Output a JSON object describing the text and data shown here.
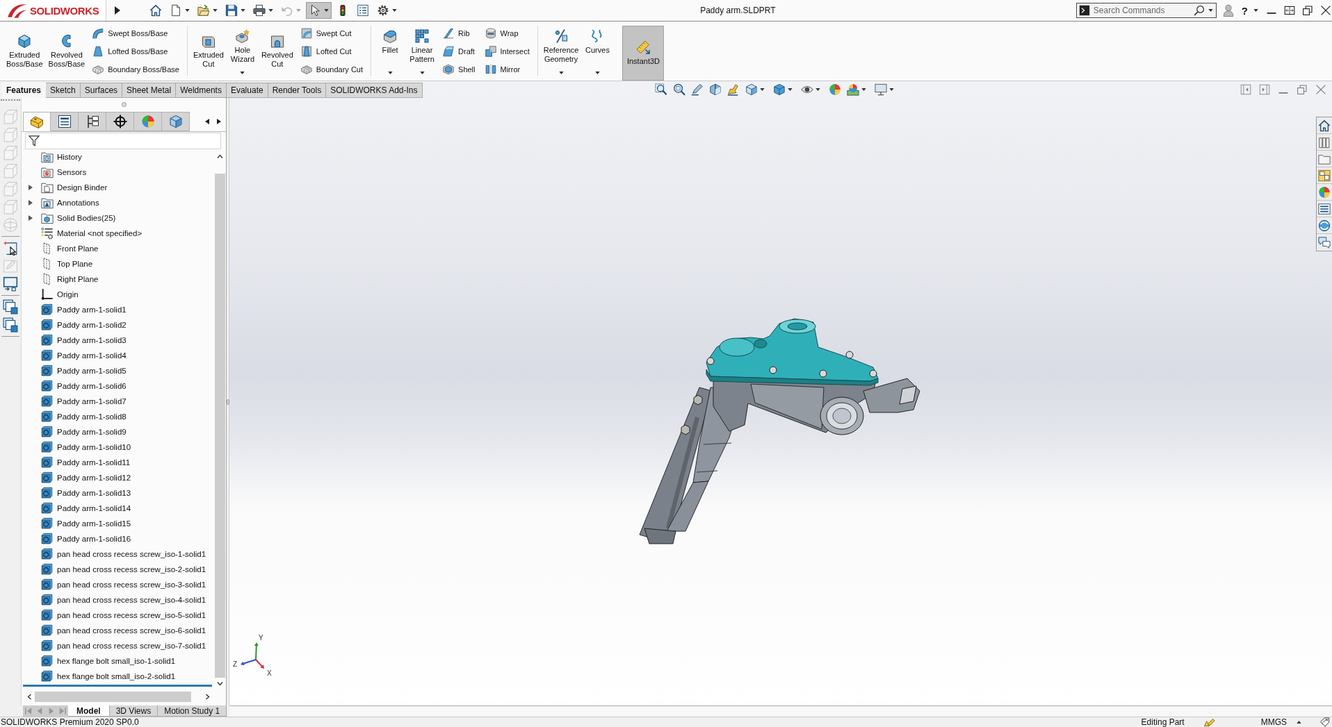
{
  "title_bar": {
    "logo": "SOLIDWORKS",
    "quick_access": [
      {
        "has_menu": false,
        "pressed": false,
        "disabled": false
      },
      {
        "has_menu": true,
        "pressed": false,
        "disabled": false
      },
      {
        "has_menu": true,
        "pressed": false,
        "disabled": false
      },
      {
        "has_menu": true,
        "pressed": false,
        "disabled": false
      },
      {
        "has_menu": true,
        "pressed": false,
        "disabled": false
      },
      {
        "has_menu": true,
        "pressed": false,
        "disabled": true
      },
      {
        "has_menu": true,
        "pressed": true,
        "disabled": false
      },
      {
        "has_menu": false,
        "pressed": false,
        "disabled": false
      },
      {
        "has_menu": false,
        "pressed": false,
        "disabled": false
      },
      {
        "has_menu": true,
        "pressed": false,
        "disabled": false
      }
    ],
    "document_title": "Paddy arm.SLDPRT",
    "search": {
      "placeholder": "Search Commands"
    },
    "help": {
      "label": "?",
      "has_menu": true
    }
  },
  "command_manager": {
    "groups": [
      [
        {
          "kind": "large",
          "label": "Extruded Boss/Base",
          "has_menu": false,
          "pressed": false
        },
        {
          "kind": "large",
          "label": "Revolved Boss/Base",
          "has_menu": false,
          "pressed": false
        },
        {
          "kind": "stack",
          "items": [
            {
              "label": "Swept Boss/Base"
            },
            {
              "label": "Lofted Boss/Base"
            },
            {
              "label": "Boundary Boss/Base"
            }
          ]
        }
      ],
      [
        {
          "kind": "large",
          "label": "Extruded Cut",
          "has_menu": false,
          "pressed": false
        },
        {
          "kind": "large",
          "label": "Hole Wizard",
          "has_menu": true,
          "pressed": false
        },
        {
          "kind": "large",
          "label": "Revolved Cut",
          "has_menu": false,
          "pressed": false
        },
        {
          "kind": "stack",
          "items": [
            {
              "label": "Swept Cut"
            },
            {
              "label": "Lofted Cut"
            },
            {
              "label": "Boundary Cut"
            }
          ]
        }
      ],
      [
        {
          "kind": "large",
          "label": "Fillet",
          "has_menu": true,
          "pressed": false
        },
        {
          "kind": "large",
          "label": "Linear Pattern",
          "has_menu": true,
          "pressed": false
        },
        {
          "kind": "stack",
          "items": [
            {
              "label": "Rib"
            },
            {
              "label": "Draft"
            },
            {
              "label": "Shell"
            }
          ]
        },
        {
          "kind": "stack",
          "items": [
            {
              "label": "Wrap"
            },
            {
              "label": "Intersect"
            },
            {
              "label": "Mirror"
            }
          ]
        }
      ],
      [
        {
          "kind": "large",
          "label": "Reference Geometry",
          "has_menu": true,
          "pressed": false
        },
        {
          "kind": "large",
          "label": "Curves",
          "has_menu": true,
          "pressed": false
        },
        {
          "kind": "large",
          "label": "Instant3D",
          "has_menu": false,
          "pressed": true
        }
      ]
    ],
    "tabs": [
      {
        "label": "Features",
        "selected": true
      },
      {
        "label": "Sketch",
        "selected": false
      },
      {
        "label": "Surfaces",
        "selected": false
      },
      {
        "label": "Sheet Metal",
        "selected": false
      },
      {
        "label": "Weldments",
        "selected": false
      },
      {
        "label": "Evaluate",
        "selected": false
      },
      {
        "label": "Render Tools",
        "selected": false
      },
      {
        "label": "SOLIDWORKS Add-Ins",
        "selected": false
      }
    ]
  },
  "left_toolbar": {
    "groups": [
      [
        {
          "disabled": true
        },
        {
          "disabled": true
        },
        {
          "disabled": true
        },
        {
          "disabled": true
        },
        {
          "disabled": true
        },
        {
          "disabled": true
        },
        {
          "disabled": true
        }
      ],
      [
        {
          "disabled": false
        },
        {
          "disabled": true
        },
        {
          "disabled": false
        }
      ],
      [
        {
          "disabled": false
        },
        {
          "disabled": false
        }
      ]
    ]
  },
  "feature_manager": {
    "tabs": [
      {
        "selected": true
      },
      {
        "selected": false
      },
      {
        "selected": false
      },
      {
        "selected": false
      },
      {
        "selected": false
      },
      {
        "selected": false
      }
    ],
    "tree": [
      {
        "label": "History",
        "kind": "history",
        "expandable": false
      },
      {
        "label": "Sensors",
        "kind": "sensors",
        "expandable": false
      },
      {
        "label": "Design Binder",
        "kind": "binder",
        "expandable": true
      },
      {
        "label": "Annotations",
        "kind": "annotations",
        "expandable": true
      },
      {
        "label": "Solid Bodies(25)",
        "kind": "bodies",
        "expandable": true
      },
      {
        "label": "Material <not specified>",
        "kind": "material",
        "expandable": false
      },
      {
        "label": "Front Plane",
        "kind": "plane",
        "expandable": false
      },
      {
        "label": "Top Plane",
        "kind": "plane",
        "expandable": false
      },
      {
        "label": "Right Plane",
        "kind": "plane",
        "expandable": false
      },
      {
        "label": "Origin",
        "kind": "origin",
        "expandable": false
      },
      {
        "label": "Paddy arm-1-solid1",
        "kind": "body",
        "expandable": false
      },
      {
        "label": "Paddy arm-1-solid2",
        "kind": "body",
        "expandable": false
      },
      {
        "label": "Paddy arm-1-solid3",
        "kind": "body",
        "expandable": false
      },
      {
        "label": "Paddy arm-1-solid4",
        "kind": "body",
        "expandable": false
      },
      {
        "label": "Paddy arm-1-solid5",
        "kind": "body",
        "expandable": false
      },
      {
        "label": "Paddy arm-1-solid6",
        "kind": "body",
        "expandable": false
      },
      {
        "label": "Paddy arm-1-solid7",
        "kind": "body",
        "expandable": false
      },
      {
        "label": "Paddy arm-1-solid8",
        "kind": "body",
        "expandable": false
      },
      {
        "label": "Paddy arm-1-solid9",
        "kind": "body",
        "expandable": false
      },
      {
        "label": "Paddy arm-1-solid10",
        "kind": "body",
        "expandable": false
      },
      {
        "label": "Paddy arm-1-solid11",
        "kind": "body",
        "expandable": false
      },
      {
        "label": "Paddy arm-1-solid12",
        "kind": "body",
        "expandable": false
      },
      {
        "label": "Paddy arm-1-solid13",
        "kind": "body",
        "expandable": false
      },
      {
        "label": "Paddy arm-1-solid14",
        "kind": "body",
        "expandable": false
      },
      {
        "label": "Paddy arm-1-solid15",
        "kind": "body",
        "expandable": false
      },
      {
        "label": "Paddy arm-1-solid16",
        "kind": "body",
        "expandable": false
      },
      {
        "label": "pan head cross recess screw_iso-1-solid1",
        "kind": "body",
        "expandable": false
      },
      {
        "label": "pan head cross recess screw_iso-2-solid1",
        "kind": "body",
        "expandable": false
      },
      {
        "label": "pan head cross recess screw_iso-3-solid1",
        "kind": "body",
        "expandable": false
      },
      {
        "label": "pan head cross recess screw_iso-4-solid1",
        "kind": "body",
        "expandable": false
      },
      {
        "label": "pan head cross recess screw_iso-5-solid1",
        "kind": "body",
        "expandable": false
      },
      {
        "label": "pan head cross recess screw_iso-6-solid1",
        "kind": "body",
        "expandable": false
      },
      {
        "label": "pan head cross recess screw_iso-7-solid1",
        "kind": "body",
        "expandable": false
      },
      {
        "label": "hex flange bolt small_iso-1-solid1",
        "kind": "body",
        "expandable": false
      },
      {
        "label": "hex flange bolt small_iso-2-solid1",
        "kind": "body",
        "expandable": false
      }
    ],
    "tab_nav": [
      {
        "disabled": true
      },
      {
        "disabled": true
      },
      {
        "disabled": true
      },
      {
        "disabled": true
      }
    ],
    "bottom_tabs": [
      {
        "label": "Model",
        "selected": true
      },
      {
        "label": "3D Views",
        "selected": false
      },
      {
        "label": "Motion Study 1",
        "selected": false
      }
    ]
  },
  "viewport": {
    "triad": {
      "axes": [
        {
          "label": "X",
          "color": "#d42a2a"
        },
        {
          "label": "Y",
          "color": "#2a9a2a"
        },
        {
          "label": "Z",
          "color": "#2a4fd0"
        }
      ]
    }
  },
  "status_bar": {
    "product": "SOLIDWORKS Premium 2020 SP0.0",
    "mode": "Editing Part",
    "units": "MMGS"
  }
}
